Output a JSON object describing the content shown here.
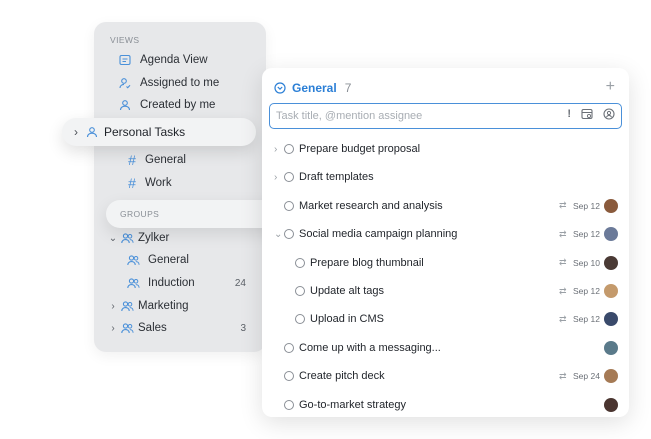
{
  "sidebar": {
    "views_label": "VIEWS",
    "views": [
      {
        "label": "Agenda View",
        "icon": "calendar-icon"
      },
      {
        "label": "Assigned to me",
        "icon": "user-assigned-icon"
      },
      {
        "label": "Created by me",
        "icon": "user-created-icon"
      }
    ],
    "personal_tasks": {
      "label": "Personal Tasks",
      "icon": "user-icon"
    },
    "personal_lists": [
      {
        "label": "General"
      },
      {
        "label": "Work"
      }
    ],
    "groups_label": "GROUPS",
    "groups": [
      {
        "label": "Zylker",
        "expanded": true
      },
      {
        "label": "General",
        "child": true,
        "count": ""
      },
      {
        "label": "Induction",
        "child": true,
        "count": "24"
      },
      {
        "label": "Marketing",
        "expanded": false,
        "count": ""
      },
      {
        "label": "Sales",
        "expanded": false,
        "count": "3"
      }
    ]
  },
  "panel": {
    "title": "General",
    "count": "7",
    "input_placeholder": "Task title, @mention assignee",
    "tasks": [
      {
        "title": "Prepare budget proposal",
        "level": 0,
        "chevron": "›",
        "due": "",
        "avatar": "",
        "subtask": false
      },
      {
        "title": "Draft templates",
        "level": 0,
        "chevron": "›",
        "due": "",
        "avatar": "",
        "subtask": false
      },
      {
        "title": "Market research and analysis",
        "level": 0,
        "chevron": "",
        "due": "Sep 12",
        "avatar": "#8a5a3c",
        "subtask": true
      },
      {
        "title": "Social media campaign planning",
        "level": 0,
        "chevron": "⌄",
        "due": "Sep 12",
        "avatar": "#6b7a99",
        "subtask": true
      },
      {
        "title": "Prepare blog thumbnail",
        "level": 1,
        "chevron": "",
        "due": "Sep 10",
        "avatar": "#4a3a35",
        "subtask": true
      },
      {
        "title": "Update alt tags",
        "level": 1,
        "chevron": "",
        "due": "Sep 12",
        "avatar": "#c49a6c",
        "subtask": true
      },
      {
        "title": "Upload in CMS",
        "level": 1,
        "chevron": "",
        "due": "Sep 12",
        "avatar": "#3a4a6b",
        "subtask": true
      },
      {
        "title": "Come up with a messaging...",
        "level": 0,
        "chevron": "",
        "due": "",
        "avatar": "#5a7a8a",
        "subtask": false
      },
      {
        "title": "Create pitch deck",
        "level": 0,
        "chevron": "",
        "due": "Sep 24",
        "avatar": "#a57a55",
        "subtask": true
      },
      {
        "title": "Go-to-market strategy",
        "level": 0,
        "chevron": "",
        "due": "",
        "avatar": "#4a3530",
        "subtask": false
      }
    ]
  },
  "colors": {
    "accent": "#2b7fd6",
    "sidebar_bg": "#e7e8ea"
  }
}
